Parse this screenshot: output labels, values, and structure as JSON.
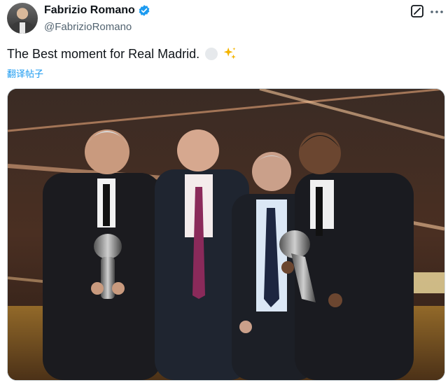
{
  "author": {
    "display_name": "Fabrizio Romano",
    "handle": "@FabrizioRomano",
    "verified": true
  },
  "tweet": {
    "text": "The Best moment for Real Madrid.",
    "emojis": [
      "white-circle",
      "sparkles"
    ],
    "translate_label": "翻译帖子"
  },
  "icons": {
    "verified": "verified-badge-icon",
    "grok": "grok-icon",
    "more": "more-icon"
  },
  "colors": {
    "accent": "#1d9bf0",
    "text": "#0f1419",
    "secondary_text": "#536471"
  },
  "media": {
    "type": "photo",
    "description_visible": "Four men in suits posing with two trophies on a stage"
  }
}
